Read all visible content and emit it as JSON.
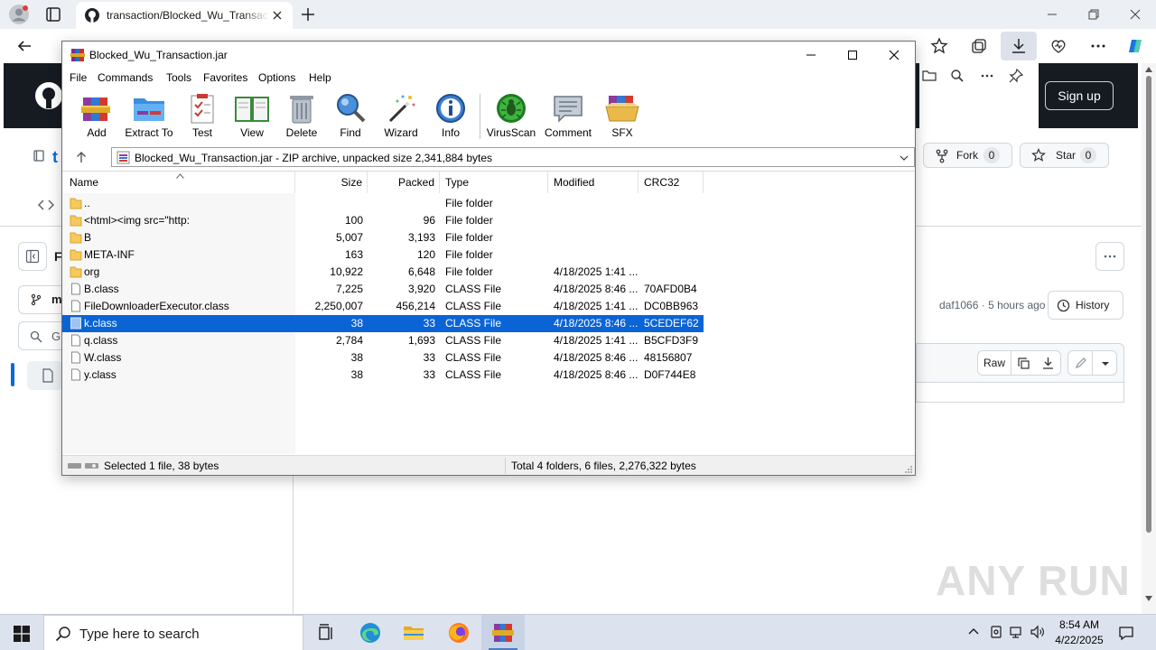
{
  "browser": {
    "tab_title": "transaction/Blocked_Wu_Transaction",
    "window_controls": [
      "minimize-icon",
      "restore-icon",
      "close-icon"
    ]
  },
  "github": {
    "sign_up": "Sign up",
    "repo_fragment": "t",
    "fork_label": "Fork",
    "fork_count": "0",
    "star_label": "Star",
    "star_count": "0",
    "branch_fragment": "m",
    "search_fragment": "G",
    "sidebar_title_fragment": "F",
    "commit_author": "daf1066",
    "commit_time": "5 hours ago",
    "history_label": "History",
    "raw_label": "Raw"
  },
  "winrar": {
    "title": "Blocked_Wu_Transaction.jar",
    "menu": [
      "File",
      "Commands",
      "Tools",
      "Favorites",
      "Options",
      "Help"
    ],
    "toolbar": [
      {
        "label": "Add",
        "icon": "add-icon"
      },
      {
        "label": "Extract To",
        "icon": "extract-to-icon"
      },
      {
        "label": "Test",
        "icon": "test-icon"
      },
      {
        "label": "View",
        "icon": "view-icon"
      },
      {
        "label": "Delete",
        "icon": "delete-icon"
      },
      {
        "label": "Find",
        "icon": "find-icon"
      },
      {
        "label": "Wizard",
        "icon": "wizard-icon"
      },
      {
        "label": "Info",
        "icon": "info-icon"
      },
      {
        "label": "VirusScan",
        "icon": "virusscan-icon"
      },
      {
        "label": "Comment",
        "icon": "comment-icon"
      },
      {
        "label": "SFX",
        "icon": "sfx-icon"
      }
    ],
    "address": "Blocked_Wu_Transaction.jar - ZIP archive, unpacked size 2,341,884 bytes",
    "columns": {
      "name": "Name",
      "size": "Size",
      "packed": "Packed",
      "type": "Type",
      "modified": "Modified",
      "crc": "CRC32"
    },
    "rows": [
      {
        "name": "..",
        "size": "",
        "packed": "",
        "type": "File folder",
        "modified": "",
        "crc": "",
        "kind": "folder"
      },
      {
        "name": "<html><img src=\"http:",
        "size": "100",
        "packed": "96",
        "type": "File folder",
        "modified": "",
        "crc": "",
        "kind": "folder"
      },
      {
        "name": "B",
        "size": "5,007",
        "packed": "3,193",
        "type": "File folder",
        "modified": "",
        "crc": "",
        "kind": "folder"
      },
      {
        "name": "META-INF",
        "size": "163",
        "packed": "120",
        "type": "File folder",
        "modified": "",
        "crc": "",
        "kind": "folder"
      },
      {
        "name": "org",
        "size": "10,922",
        "packed": "6,648",
        "type": "File folder",
        "modified": "4/18/2025 1:41 ...",
        "crc": "",
        "kind": "folder"
      },
      {
        "name": "B.class",
        "size": "7,225",
        "packed": "3,920",
        "type": "CLASS File",
        "modified": "4/18/2025 8:46 ...",
        "crc": "70AFD0B4",
        "kind": "file"
      },
      {
        "name": "FileDownloaderExecutor.class",
        "size": "2,250,007",
        "packed": "456,214",
        "type": "CLASS File",
        "modified": "4/18/2025 1:41 ...",
        "crc": "DC0BB963",
        "kind": "file"
      },
      {
        "name": "k.class",
        "size": "38",
        "packed": "33",
        "type": "CLASS File",
        "modified": "4/18/2025 8:46 ...",
        "crc": "5CEDEF62",
        "kind": "file",
        "selected": true
      },
      {
        "name": "q.class",
        "size": "2,784",
        "packed": "1,693",
        "type": "CLASS File",
        "modified": "4/18/2025 1:41 ...",
        "crc": "B5CFD3F9",
        "kind": "file"
      },
      {
        "name": "W.class",
        "size": "38",
        "packed": "33",
        "type": "CLASS File",
        "modified": "4/18/2025 8:46 ...",
        "crc": "48156807",
        "kind": "file"
      },
      {
        "name": "y.class",
        "size": "38",
        "packed": "33",
        "type": "CLASS File",
        "modified": "4/18/2025 8:46 ...",
        "crc": "D0F744E8",
        "kind": "file"
      }
    ],
    "status_left": "Selected 1 file, 38 bytes",
    "status_right": "Total 4 folders, 6 files, 2,276,322 bytes",
    "selection_color": "#0a64d6"
  },
  "watermark": "ANY RUN",
  "taskbar": {
    "search_placeholder": "Type here to search",
    "apps": [
      "task-view-icon",
      "edge-icon",
      "file-explorer-icon",
      "firefox-icon",
      "winrar-icon"
    ],
    "time": "8:54 AM",
    "date": "4/22/2025"
  }
}
